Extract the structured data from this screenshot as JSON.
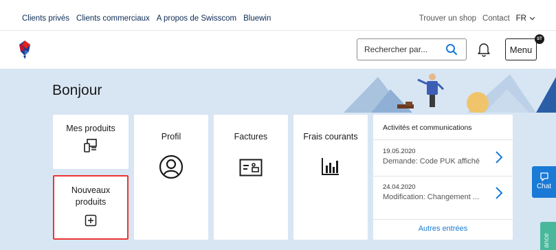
{
  "topnav": {
    "items": [
      "Clients privés",
      "Clients commerciaux",
      "A propos de Swisscom",
      "Bluewin"
    ],
    "right": [
      "Trouver un shop",
      "Contact"
    ],
    "language": "FR"
  },
  "header": {
    "logo_icon": "swisscom-logo-icon",
    "search_placeholder": "Rechercher par...",
    "menu_label": "Menu",
    "avatar_initials": "ST"
  },
  "hero": {
    "greeting": "Bonjour"
  },
  "tiles": {
    "mes_produits": "Mes produits",
    "nouveaux_produits": "Nouveaux produits",
    "profil": "Profil",
    "factures": "Factures",
    "frais_courants": "Frais courants"
  },
  "activity": {
    "title": "Activités et communications",
    "items": [
      {
        "date": "19.05.2020",
        "text": "Demande: Code PUK affiché"
      },
      {
        "date": "24.04.2020",
        "text": "Modification: Changement ..."
      }
    ],
    "more_label": "Autres entrées"
  },
  "side": {
    "chat_label": "Chat",
    "green_tab_label": "ance"
  },
  "colors": {
    "accent": "#1a7ad6",
    "selected_border": "#ee3333",
    "background": "#d8e6f4",
    "green_tab": "#49b89a"
  }
}
